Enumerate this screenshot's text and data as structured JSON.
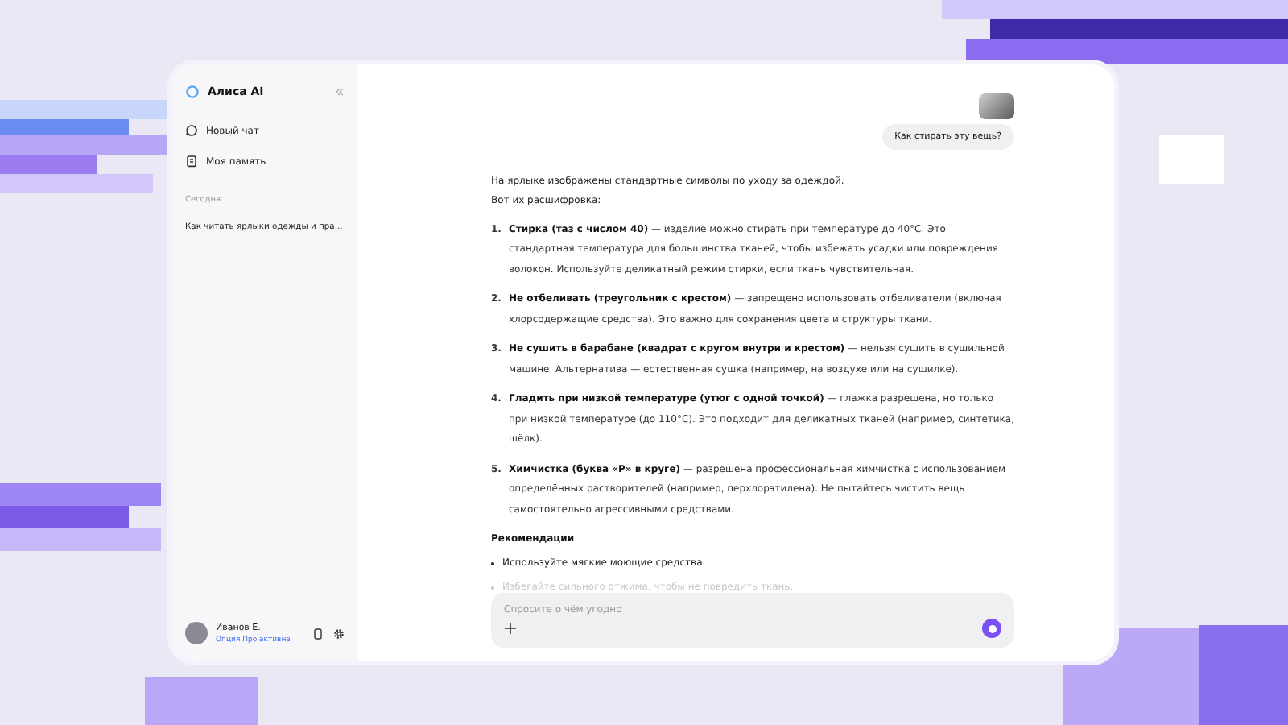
{
  "sidebar": {
    "brand": "Алиса AI",
    "items": [
      {
        "kind": "chat",
        "label": "Новый чат"
      },
      {
        "kind": "memory",
        "label": "Моя память"
      }
    ],
    "section": "Сегодня",
    "history": [
      {
        "label": "Как читать ярлыки одежды и пра...",
        "selected": false
      }
    ],
    "user": {
      "name": "Иванов Е.",
      "plan": "Опция Про активна"
    }
  },
  "chat": {
    "user_message": "Как стирать эту вещь?",
    "intro": [
      "На ярлыке изображены стандартные символы по уходу за одеждой.",
      "Вот их расшифровка:"
    ],
    "items": [
      {
        "number": "1.",
        "text": "**Стирка (таз с числом 40)** — изделие можно стирать при температуре до 40°C. Это стандартная температура для большинства тканей, чтобы избежать усадки или повреждения волокон. Используйте деликатный режим стирки, если ткань чувствительная."
      },
      {
        "number": "2.",
        "text": "**Не отбеливать (треугольник с крестом)** — запрещено использовать отбеливатели (включая хлорсодержащие средства). Это важно для сохранения цвета и структуры ткани."
      },
      {
        "number": "3.",
        "text": "**Не сушить в барабане (квадрат с кругом внутри и крестом)** — нельзя сушить в сушильной машине. Альтернатива — естественная сушка (например, на воздухе или на сушилке)."
      },
      {
        "number": "4.",
        "text": "**Гладить при низкой температуре (утюг с одной точкой)** — глажка разрешена, но только при низкой температуре (до 110°C). Это подходит для деликатных тканей (например, синтетика, шёлк)."
      },
      {
        "number": "5.",
        "text": "**Химчистка (буква «P» в круге)** — разрешена профессиональная химчистка с использованием определённых растворителей (например, перхлорэтилена). Не пытайтесь чистить вещь самостоятельно агрессивными средствами."
      }
    ],
    "recommendations_title": "Рекомендации",
    "recommendations": [
      {
        "text": "Используйте мягкие моющие средства.",
        "faded": false
      },
      {
        "text": "Избегайте сильного отжима, чтобы не повредить ткань.",
        "faded": true
      }
    ],
    "input": {
      "placeholder": "Спросите о чём угодно"
    }
  }
}
